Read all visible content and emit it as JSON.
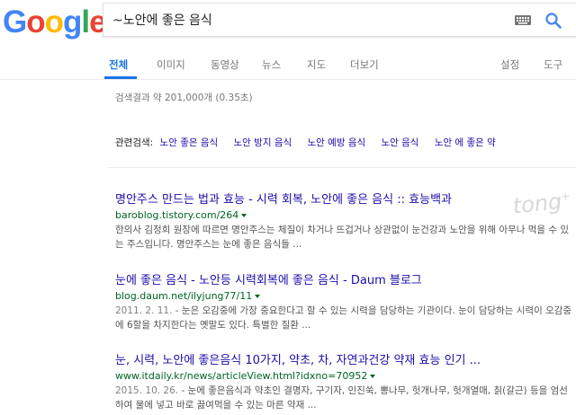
{
  "logo": {
    "letters": [
      "G",
      "o",
      "o",
      "g",
      "l",
      "e"
    ],
    "colors": [
      "#4285F4",
      "#EA4335",
      "#FBBC05",
      "#4285F4",
      "#34A853",
      "#EA4335"
    ]
  },
  "search": {
    "query": "~노안에 좋은 음식"
  },
  "tabs": {
    "all": "전체",
    "images": "이미지",
    "videos": "동영상",
    "news": "뉴스",
    "maps": "지도",
    "more": "더보기",
    "settings": "설정",
    "tools": "도구"
  },
  "stats": "검색결과 약 201,000개 (0.35초)",
  "related": {
    "label": "관련검색:",
    "items": [
      "노안 좋은 음식",
      "노안 방지 음식",
      "노안 예방 음식",
      "노안 음식",
      "노안 에 좋은 약"
    ]
  },
  "results": [
    {
      "title": "명안주스 만드는 법과 효능 - 시력 회복, 노안에 좋은 음식 :: 효능백과",
      "url": "baroblog.tistory.com/264",
      "snippet": [
        "한의사 김정희 원장에 따르면 명안주스는 체질이 차거나 뜨겁거나 상관없이 눈건강과 노안을 위해 아무나 먹을 수 있는 주스입니다. 명안주스는 눈에 좋은 음식들 ..."
      ]
    },
    {
      "title": "눈에 좋은 음식 - 노안등 시력회복에 좋은 음식 - Daum 블로그",
      "url": "blog.daum.net/ilyjung77/11",
      "date": "2011. 2. 11.",
      "snippet": [
        "- 눈은 오감중에 가장 중요한다고 할 수 있는 시력을 담당하는 기관이다. 눈이 담당하는 시력이 오감중에 6할을 차지한다는 옛말도 있다. 특별한 질환 ..."
      ]
    },
    {
      "title": "눈, 시력, 노안에 좋은음식 10가지, 약초, 차, 자연과건강 약재 효능 인기 ...",
      "url": "www.itdaily.kr/news/articleView.html?idxno=70952",
      "date": "2015. 10. 26.",
      "snippet": [
        "- 눈에 좋은음식과 약초인 결명자, 구기자, 인진쑥, 뽕나무, 헛개나무, 헛개열매, 칡(갈근) 등을 엄선하여 물에 넣고 바로 끓여먹을 수 있는 마른 약재 ..."
      ]
    }
  ],
  "colors": {
    "link": "#1a0dab",
    "url": "#006621",
    "accent": "#1a73e8",
    "snippet": "#545454"
  }
}
